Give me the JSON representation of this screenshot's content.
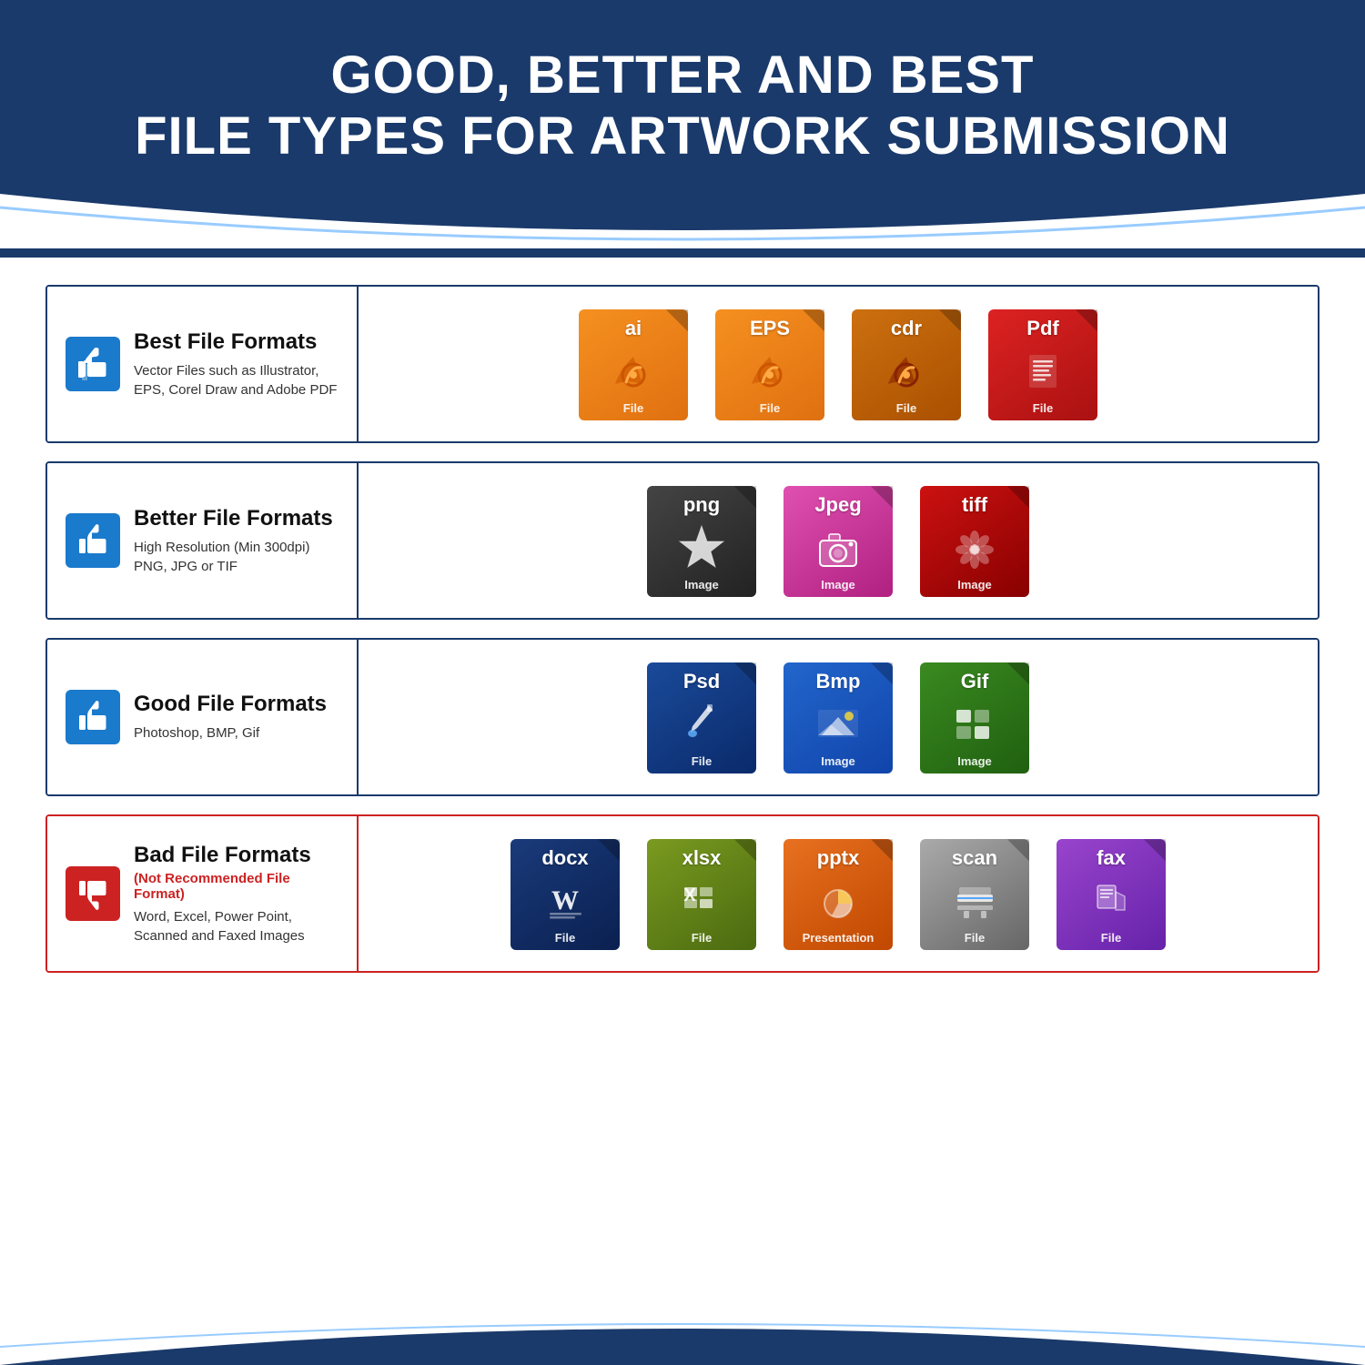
{
  "header": {
    "title_line1": "GOOD, BETTER AND BEST",
    "title_line2": "FILE TYPES FOR ARTWORK SUBMISSION"
  },
  "rows": [
    {
      "id": "best",
      "label": "Best File Formats",
      "subtitle": "",
      "desc": "Vector Files such as Illustrator,\nEPS, Corel Draw and Adobe PDF",
      "thumb_type": "thumbs-up",
      "is_bad": false,
      "icons": [
        {
          "ext": "ai",
          "color": "orange",
          "label": "File",
          "graphic": "pen"
        },
        {
          "ext": "EPS",
          "color": "orange",
          "label": "File",
          "graphic": "pen"
        },
        {
          "ext": "cdr",
          "color": "dark-orange",
          "label": "File",
          "graphic": "pen"
        },
        {
          "ext": "Pdf",
          "color": "red",
          "label": "File",
          "graphic": "doc"
        }
      ]
    },
    {
      "id": "better",
      "label": "Better File Formats",
      "subtitle": "",
      "desc": "High Resolution (Min 300dpi)\nPNG, JPG or TIF",
      "thumb_type": "thumbs-up",
      "is_bad": false,
      "icons": [
        {
          "ext": "png",
          "color": "dark",
          "label": "Image",
          "graphic": "star"
        },
        {
          "ext": "Jpeg",
          "color": "pink",
          "label": "Image",
          "graphic": "camera"
        },
        {
          "ext": "tiff",
          "color": "dark-red",
          "label": "Image",
          "graphic": "flower"
        }
      ]
    },
    {
      "id": "good",
      "label": "Good File Formats",
      "subtitle": "",
      "desc": "Photoshop, BMP, Gif",
      "thumb_type": "thumbs-up",
      "is_bad": false,
      "icons": [
        {
          "ext": "Psd",
          "color": "dark-blue",
          "label": "File",
          "graphic": "brush"
        },
        {
          "ext": "Bmp",
          "color": "blue",
          "label": "Image",
          "graphic": "mountain"
        },
        {
          "ext": "Gif",
          "color": "green",
          "label": "Image",
          "graphic": "grid"
        }
      ]
    },
    {
      "id": "bad",
      "label": "Bad File Formats",
      "subtitle": "(Not Recommended File Format)",
      "desc": "Word, Excel, Power Point,\nScanned and Faxed Images",
      "thumb_type": "thumbs-down",
      "is_bad": true,
      "icons": [
        {
          "ext": "docx",
          "color": "dark-blue2",
          "label": "File",
          "graphic": "word"
        },
        {
          "ext": "xlsx",
          "color": "olive",
          "label": "File",
          "graphic": "excel"
        },
        {
          "ext": "pptx",
          "color": "orange-ppt",
          "label": "Presentation",
          "graphic": "ppt"
        },
        {
          "ext": "scan",
          "color": "dark-gray",
          "label": "File",
          "graphic": "scanner"
        },
        {
          "ext": "fax",
          "color": "purple",
          "label": "File",
          "graphic": "fax"
        }
      ]
    }
  ]
}
